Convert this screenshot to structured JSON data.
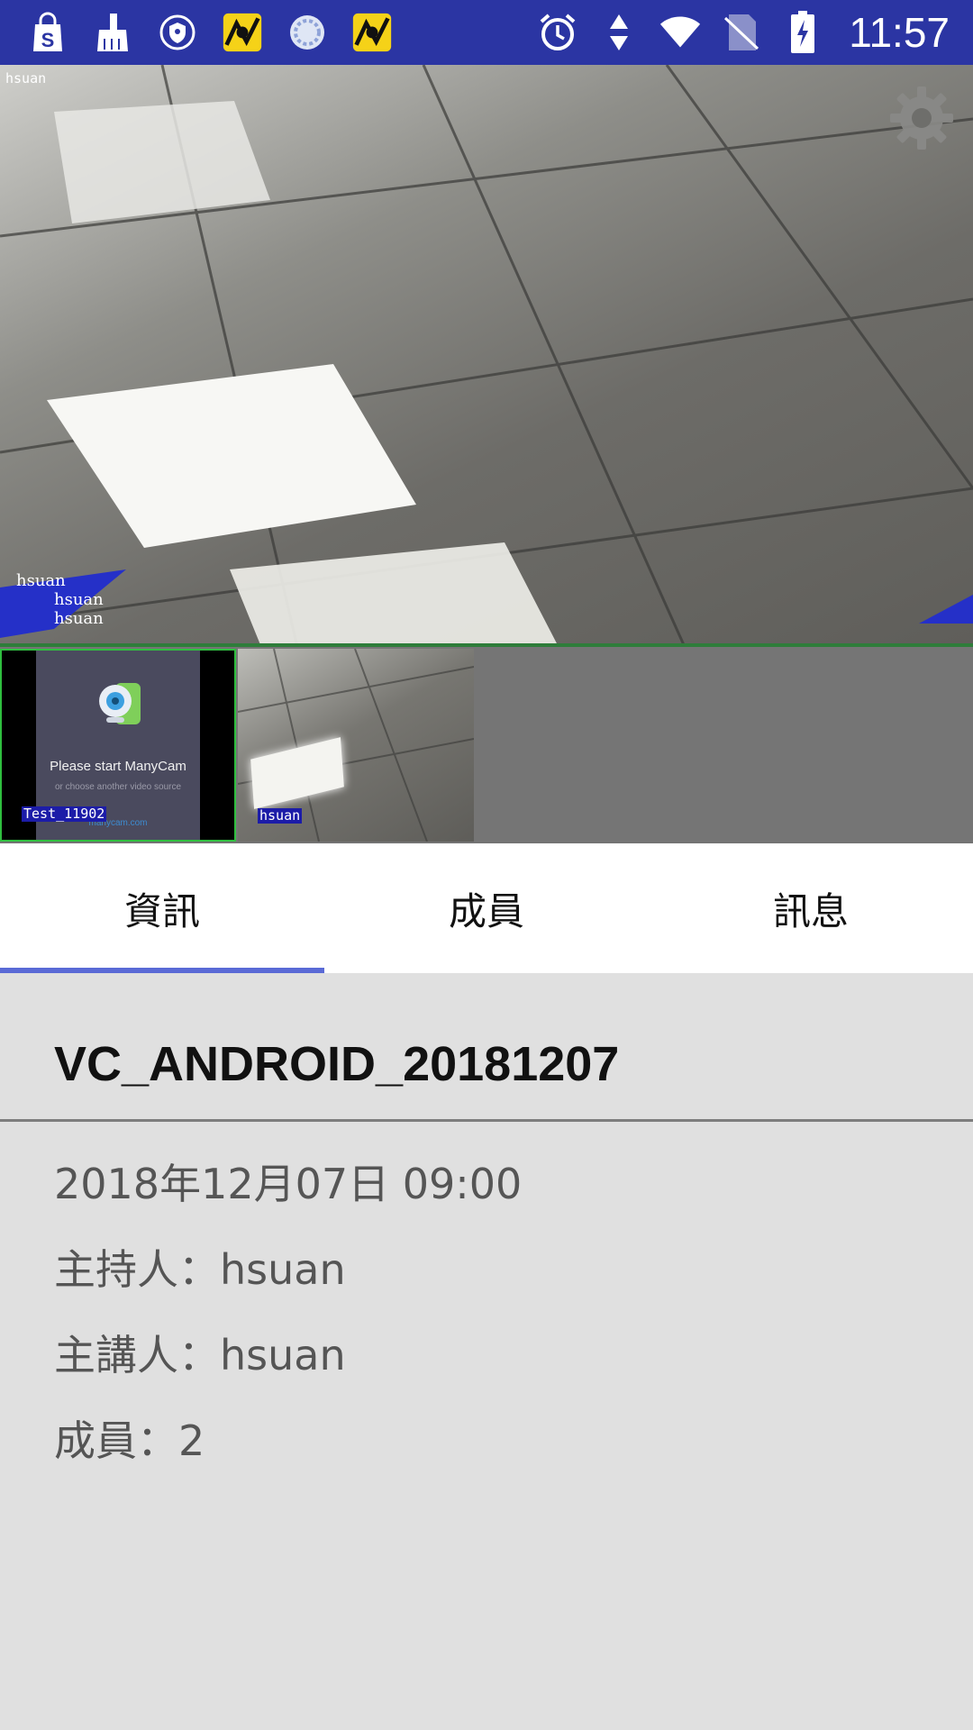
{
  "status_bar": {
    "time": "11:57",
    "left_icons": [
      "shopping-bag-icon",
      "broom-icon",
      "shield-icon",
      "cartoon-app-icon",
      "loading-circle-icon",
      "cartoon-app-icon"
    ],
    "right_icons": [
      "alarm-icon",
      "data-arrows-icon",
      "wifi-icon",
      "no-sim-icon",
      "battery-charging-icon"
    ],
    "background_color": "#2b35a3"
  },
  "main_video": {
    "corner_label": "hsuan",
    "overlay_labels": [
      "hsuan",
      "hsuan",
      "hsuan"
    ],
    "settings_icon": "gear-icon"
  },
  "thumbnails": [
    {
      "label": "Test_11902",
      "placeholder_title": "Please start ManyCam",
      "placeholder_subtitle": "or choose another video source",
      "placeholder_url": "manycam.com"
    },
    {
      "label": "hsuan"
    }
  ],
  "tabs": [
    {
      "label": "資訊",
      "active": true
    },
    {
      "label": "成員",
      "active": false
    },
    {
      "label": "訊息",
      "active": false
    }
  ],
  "accent_color": "#5a6ad6",
  "info": {
    "meeting_name": "VC_ANDROID_20181207",
    "date": "2018年12月07日 09:00",
    "host": "主持人：hsuan",
    "speaker": "主講人：hsuan",
    "members": "成員：2"
  }
}
